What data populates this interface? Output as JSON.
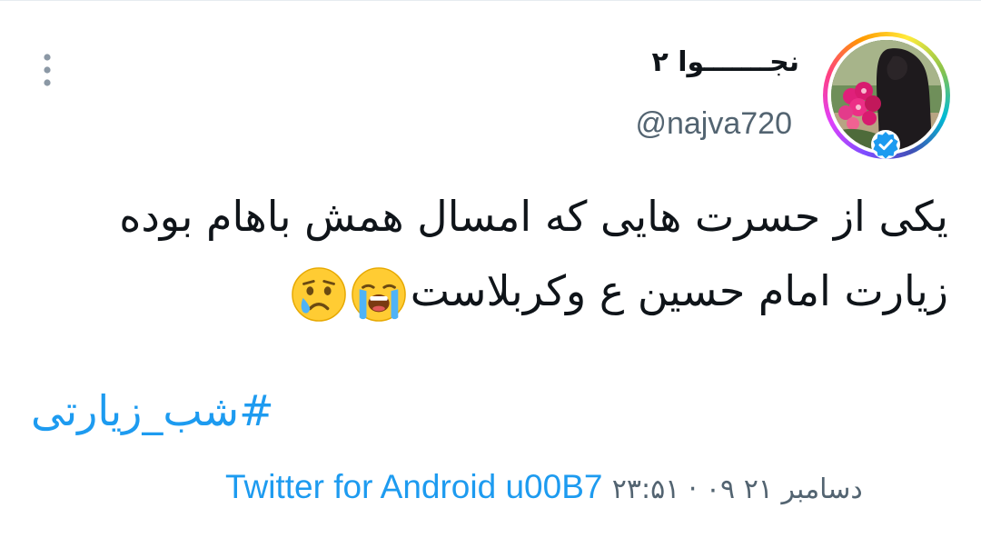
{
  "tweet": {
    "display_name": "نجـــــــوا ۲",
    "handle": "@najva720",
    "text_line_1": "یکی از حسرت هایی که امسال همش باهام بوده",
    "text_line_2": "زیارت امام حسین ع وکربلاست",
    "emoji_1": "loudly-crying-face",
    "emoji_2": "crying-face",
    "hashtag": "#شب_زیارتی",
    "timestamp": "۲۳:۵۱ · ۰۹ دسامبر ۲۱",
    "source_separator": "u00B7",
    "source": "Twitter for Android"
  },
  "icons": {
    "verified": "verified-badge-icon",
    "more": "more-vertical-icon"
  },
  "colors": {
    "link": "#1d9bf0",
    "secondary": "#536471",
    "primary": "#0f1419",
    "verified": "#1d9bf0"
  }
}
